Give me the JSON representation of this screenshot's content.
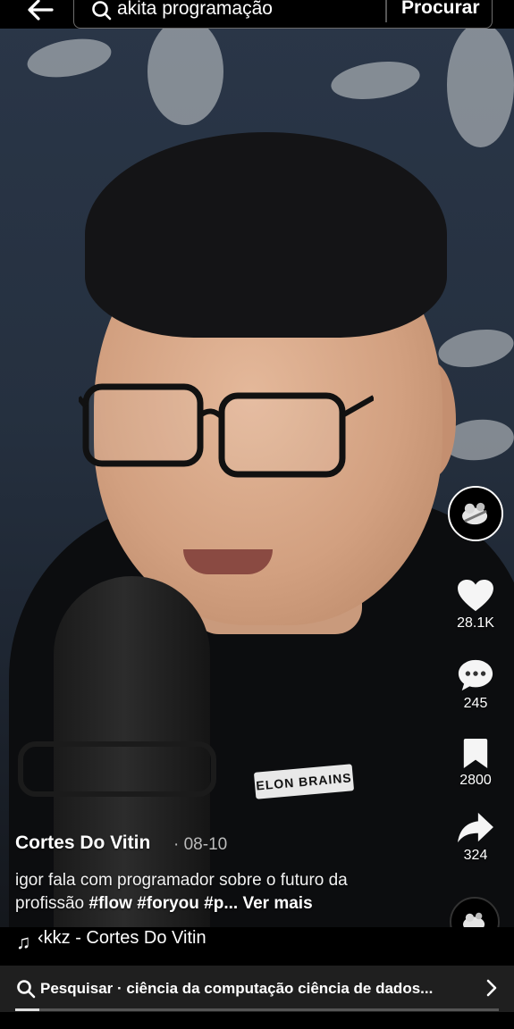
{
  "search": {
    "query": "akita programação",
    "submit_label": "Procurar"
  },
  "rail": {
    "likes": "28.1K",
    "comments": "245",
    "saves": "2800",
    "shares": "324"
  },
  "video_overlay": {
    "shirt_logo": "ELON BRAINS"
  },
  "post": {
    "author": "Cortes Do Vitin",
    "date": "· 08-10",
    "caption_text": "igor fala com programador sobre o futuro da profissão ",
    "caption_tags": "#flow #foryou #p...",
    "see_more": "Ver mais"
  },
  "music": {
    "label": "‹kkz - Cortes Do Vitin"
  },
  "bottom_bar": {
    "text": "Pesquisar · ciência da computação ciência de dados..."
  },
  "playback": {
    "progress_fraction": 0.05
  },
  "icons": {
    "back": "arrow-left-icon",
    "search": "search-icon",
    "like": "heart-icon",
    "comment": "comment-icon",
    "save": "bookmark-icon",
    "share": "share-icon",
    "music": "music-note-icon",
    "chevron": "chevron-right-icon"
  }
}
